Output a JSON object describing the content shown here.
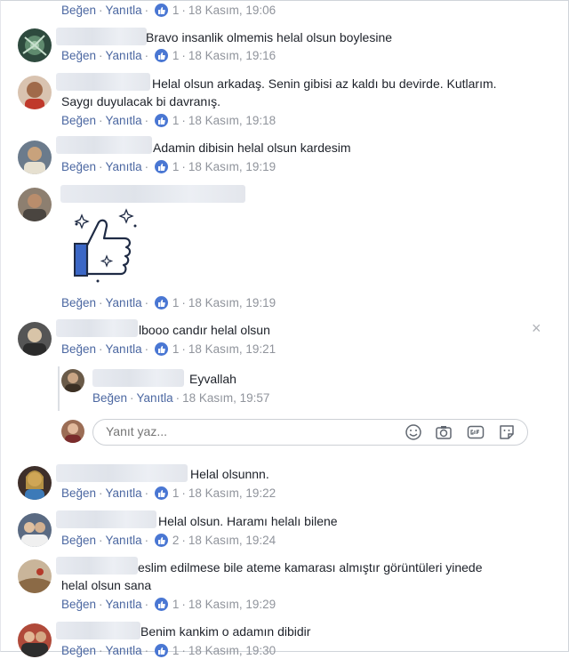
{
  "actions": {
    "like": "Beğen",
    "reply": "Yanıtla"
  },
  "reply_input": {
    "placeholder": "Yanıt yaz..."
  },
  "close_symbol": "×",
  "comments": [
    {
      "text": "",
      "likes": "1",
      "time": "18 Kasım, 19:06"
    },
    {
      "text": "Bravo insanlik olmemis helal olsun boylesine",
      "likes": "1",
      "time": "18 Kasım, 19:16"
    },
    {
      "text": "Helal olsun arkadaş. Senin gibisi az kaldı bu devirde. Kutlarım.",
      "text2": "Saygı duyulacak bi davranış.",
      "likes": "1",
      "time": "18 Kasım, 19:18"
    },
    {
      "text": "Adamin dibisin helal olsun kardesim",
      "likes": "1",
      "time": "18 Kasım, 19:19"
    },
    {
      "text": "",
      "sticker": "thumbs-up",
      "likes": "1",
      "time": "18 Kasım, 19:19"
    },
    {
      "text": "lbooo candır helal olsun",
      "likes": "1",
      "time": "18 Kasım, 19:21"
    },
    {
      "text": "Helal olsunnn.",
      "likes": "1",
      "time": "18 Kasım, 19:22"
    },
    {
      "text": "Helal olsun. Haramı helalı bilene",
      "likes": "2",
      "time": "18 Kasım, 19:24"
    },
    {
      "text": "eslim edilmese bile ateme kamarası almıştır görüntüleri yinede",
      "text2": "helal olsun sana",
      "likes": "1",
      "time": "18 Kasım, 19:29"
    },
    {
      "text": "Benim kankim o adamın dibidir",
      "likes": "1",
      "time": "18 Kasım, 19:30"
    }
  ],
  "reply": {
    "text": "Eyvallah",
    "time": "18 Kasım, 19:57"
  }
}
